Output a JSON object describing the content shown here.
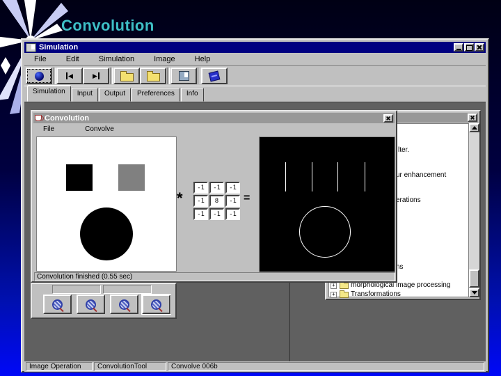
{
  "slide": {
    "title": "Convolution",
    "title_color": "#3ec0c6"
  },
  "app": {
    "window_title": "Simulation",
    "menu": [
      "File",
      "Edit",
      "Simulation",
      "Image",
      "Help"
    ],
    "toolbar_icons": [
      "run-icon",
      "step-first-icon",
      "step-last-icon",
      "open-folder-icon",
      "open-folder-icon",
      "save-icon",
      "help-book-icon"
    ],
    "window_control_icons": [
      "minimize-icon",
      "maximize-icon",
      "close-icon"
    ],
    "tabs": [
      "Simulation",
      "Input",
      "Output",
      "Preferences",
      "Info"
    ],
    "active_tab": "Simulation",
    "statusbar": {
      "cells": [
        "Image Operation",
        "ConvolutionTool",
        "Convolve 006b"
      ]
    }
  },
  "conv": {
    "window_title": "Convolution",
    "menu": [
      "File",
      "Convolve"
    ],
    "operator": "*",
    "equals": "=",
    "kernel": [
      [
        "-1",
        "-1",
        "-1"
      ],
      [
        "-1",
        "8",
        "-1"
      ],
      [
        "-1",
        "-1",
        "-1"
      ]
    ],
    "status": "Convolution finished (0.55 sec)",
    "input_shapes": [
      "black-square",
      "gray-square",
      "black-circle"
    ],
    "output_shapes": [
      "4 white vertical edge lines",
      "white circle outline"
    ]
  },
  "zoom_panel": {
    "buttons": [
      "zoom-icon",
      "zoom-icon",
      "zoom-icon",
      "zoom-icon"
    ],
    "selected_index": 3
  },
  "tree": {
    "fragments": [
      "lter.",
      "ur enhancement",
      "erations",
      "ns"
    ],
    "items": [
      "morphological image processing",
      "Transformations"
    ]
  },
  "colors": {
    "titlebar_active": "#000080",
    "titlebar_inactive": "#989898",
    "chrome_gray": "#c0c0c0",
    "client_gray": "#606060",
    "slide_teal": "#3ec0c6",
    "slide_blue": "#0008f8"
  }
}
